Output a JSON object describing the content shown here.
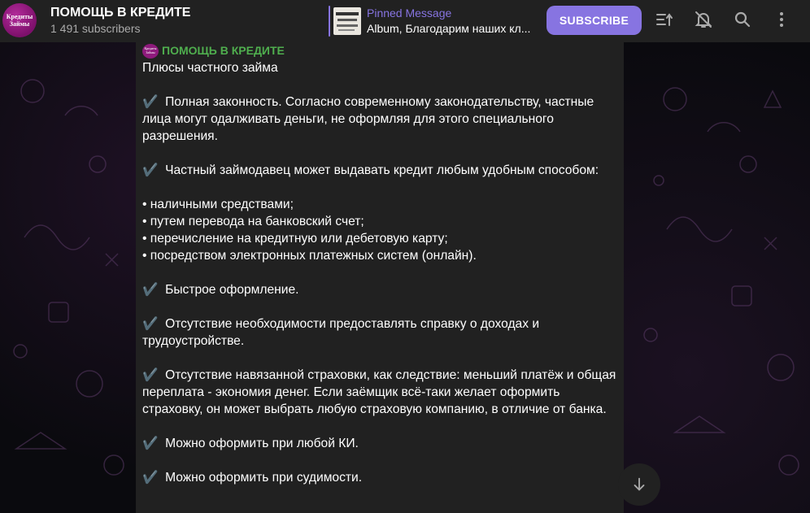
{
  "channel": {
    "title": "ПОМОЩЬ В КРЕДИТЕ",
    "subscribers": "1 491 subscribers",
    "avatar_text_line1": "Кредиты",
    "avatar_text_line2": "Займы"
  },
  "pinned": {
    "label": "Pinned Message",
    "text": "Album, Благодарим наших кл..."
  },
  "header": {
    "subscribe_label": "SUBSCRIBE",
    "icons": [
      "filter-icon",
      "mute-bell-icon",
      "search-icon",
      "more-vertical-icon"
    ]
  },
  "message": {
    "sender": "ПОМОЩЬ В КРЕДИТЕ",
    "sender_avatar_text": "Кредиты Займы",
    "lines": [
      "Плюсы частного займа",
      "",
      "✔️  Полная законность. Согласно современному законодательству, частные лица могут одалживать деньги, не оформляя для этого специального разрешения.",
      "",
      "✔️  Частный займодавец может выдавать кредит любым удобным способом:",
      "",
      "• наличными средствами;",
      "• путем перевода на банковский счет;",
      "• перечисление на кредитную или дебетовую карту;",
      "• посредством электронных платежных систем (онлайн).",
      "",
      "✔️  Быстрое оформление.",
      "",
      "✔️  Отсутствие необходимости предоставлять справку о доходах и трудоустройстве.",
      "",
      "✔️  Отсутствие навязанной страховки, как следствие: меньший платёж и общая переплата - экономия денег. Если заёмщик всё-таки желает оформить страховку, он может выбрать любую страховую компанию, в отличие от банка.",
      "",
      "✔️  Можно оформить при любой КИ.",
      "",
      "✔️  Можно оформить при судимости."
    ]
  },
  "colors": {
    "accent": "#8774e1",
    "header_bg": "#212121",
    "bubble_bg": "#212121",
    "sender_name": "#4fae4e"
  }
}
